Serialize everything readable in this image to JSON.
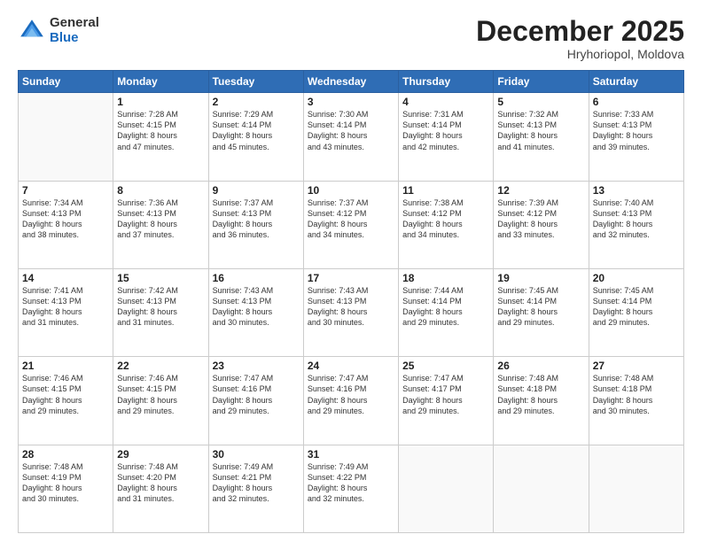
{
  "logo": {
    "general": "General",
    "blue": "Blue"
  },
  "title": "December 2025",
  "subtitle": "Hryhoriopol, Moldova",
  "days_of_week": [
    "Sunday",
    "Monday",
    "Tuesday",
    "Wednesday",
    "Thursday",
    "Friday",
    "Saturday"
  ],
  "weeks": [
    [
      {
        "day": "",
        "info": ""
      },
      {
        "day": "1",
        "info": "Sunrise: 7:28 AM\nSunset: 4:15 PM\nDaylight: 8 hours\nand 47 minutes."
      },
      {
        "day": "2",
        "info": "Sunrise: 7:29 AM\nSunset: 4:14 PM\nDaylight: 8 hours\nand 45 minutes."
      },
      {
        "day": "3",
        "info": "Sunrise: 7:30 AM\nSunset: 4:14 PM\nDaylight: 8 hours\nand 43 minutes."
      },
      {
        "day": "4",
        "info": "Sunrise: 7:31 AM\nSunset: 4:14 PM\nDaylight: 8 hours\nand 42 minutes."
      },
      {
        "day": "5",
        "info": "Sunrise: 7:32 AM\nSunset: 4:13 PM\nDaylight: 8 hours\nand 41 minutes."
      },
      {
        "day": "6",
        "info": "Sunrise: 7:33 AM\nSunset: 4:13 PM\nDaylight: 8 hours\nand 39 minutes."
      }
    ],
    [
      {
        "day": "7",
        "info": "Sunrise: 7:34 AM\nSunset: 4:13 PM\nDaylight: 8 hours\nand 38 minutes."
      },
      {
        "day": "8",
        "info": "Sunrise: 7:36 AM\nSunset: 4:13 PM\nDaylight: 8 hours\nand 37 minutes."
      },
      {
        "day": "9",
        "info": "Sunrise: 7:37 AM\nSunset: 4:13 PM\nDaylight: 8 hours\nand 36 minutes."
      },
      {
        "day": "10",
        "info": "Sunrise: 7:37 AM\nSunset: 4:12 PM\nDaylight: 8 hours\nand 34 minutes."
      },
      {
        "day": "11",
        "info": "Sunrise: 7:38 AM\nSunset: 4:12 PM\nDaylight: 8 hours\nand 34 minutes."
      },
      {
        "day": "12",
        "info": "Sunrise: 7:39 AM\nSunset: 4:12 PM\nDaylight: 8 hours\nand 33 minutes."
      },
      {
        "day": "13",
        "info": "Sunrise: 7:40 AM\nSunset: 4:13 PM\nDaylight: 8 hours\nand 32 minutes."
      }
    ],
    [
      {
        "day": "14",
        "info": "Sunrise: 7:41 AM\nSunset: 4:13 PM\nDaylight: 8 hours\nand 31 minutes."
      },
      {
        "day": "15",
        "info": "Sunrise: 7:42 AM\nSunset: 4:13 PM\nDaylight: 8 hours\nand 31 minutes."
      },
      {
        "day": "16",
        "info": "Sunrise: 7:43 AM\nSunset: 4:13 PM\nDaylight: 8 hours\nand 30 minutes."
      },
      {
        "day": "17",
        "info": "Sunrise: 7:43 AM\nSunset: 4:13 PM\nDaylight: 8 hours\nand 30 minutes."
      },
      {
        "day": "18",
        "info": "Sunrise: 7:44 AM\nSunset: 4:14 PM\nDaylight: 8 hours\nand 29 minutes."
      },
      {
        "day": "19",
        "info": "Sunrise: 7:45 AM\nSunset: 4:14 PM\nDaylight: 8 hours\nand 29 minutes."
      },
      {
        "day": "20",
        "info": "Sunrise: 7:45 AM\nSunset: 4:14 PM\nDaylight: 8 hours\nand 29 minutes."
      }
    ],
    [
      {
        "day": "21",
        "info": "Sunrise: 7:46 AM\nSunset: 4:15 PM\nDaylight: 8 hours\nand 29 minutes."
      },
      {
        "day": "22",
        "info": "Sunrise: 7:46 AM\nSunset: 4:15 PM\nDaylight: 8 hours\nand 29 minutes."
      },
      {
        "day": "23",
        "info": "Sunrise: 7:47 AM\nSunset: 4:16 PM\nDaylight: 8 hours\nand 29 minutes."
      },
      {
        "day": "24",
        "info": "Sunrise: 7:47 AM\nSunset: 4:16 PM\nDaylight: 8 hours\nand 29 minutes."
      },
      {
        "day": "25",
        "info": "Sunrise: 7:47 AM\nSunset: 4:17 PM\nDaylight: 8 hours\nand 29 minutes."
      },
      {
        "day": "26",
        "info": "Sunrise: 7:48 AM\nSunset: 4:18 PM\nDaylight: 8 hours\nand 29 minutes."
      },
      {
        "day": "27",
        "info": "Sunrise: 7:48 AM\nSunset: 4:18 PM\nDaylight: 8 hours\nand 30 minutes."
      }
    ],
    [
      {
        "day": "28",
        "info": "Sunrise: 7:48 AM\nSunset: 4:19 PM\nDaylight: 8 hours\nand 30 minutes."
      },
      {
        "day": "29",
        "info": "Sunrise: 7:48 AM\nSunset: 4:20 PM\nDaylight: 8 hours\nand 31 minutes."
      },
      {
        "day": "30",
        "info": "Sunrise: 7:49 AM\nSunset: 4:21 PM\nDaylight: 8 hours\nand 32 minutes."
      },
      {
        "day": "31",
        "info": "Sunrise: 7:49 AM\nSunset: 4:22 PM\nDaylight: 8 hours\nand 32 minutes."
      },
      {
        "day": "",
        "info": ""
      },
      {
        "day": "",
        "info": ""
      },
      {
        "day": "",
        "info": ""
      }
    ]
  ]
}
